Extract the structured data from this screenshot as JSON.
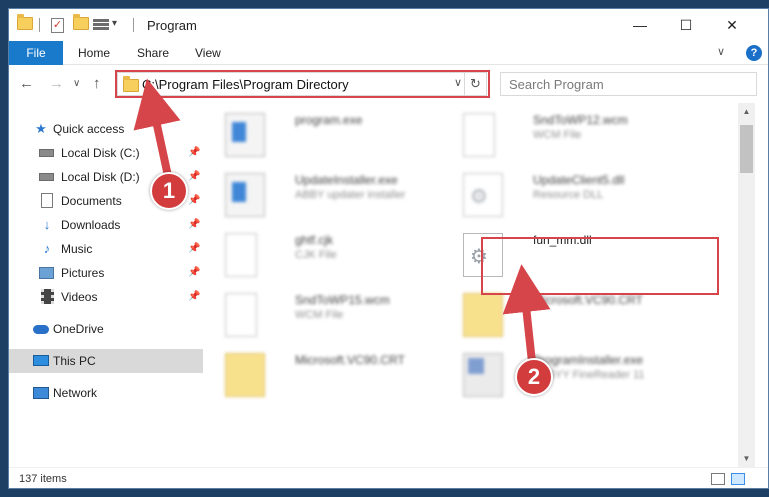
{
  "window": {
    "title": "Program",
    "minimize_glyph": "—",
    "maximize_glyph": "☐",
    "close_glyph": "✕"
  },
  "quick_access_toolbar": {
    "dropdown_glyph": "▾"
  },
  "ribbon": {
    "tabs": [
      "File",
      "Home",
      "Share",
      "View"
    ],
    "expand_glyph": "∨",
    "help_glyph": "?"
  },
  "address": {
    "back_glyph": "←",
    "forward_glyph": "→",
    "recent_glyph": "∨",
    "up_glyph": "↑",
    "path": "C:\\Program Files\\Program Directory",
    "dropdown_glyph": "∨",
    "refresh_glyph": "↻",
    "search_placeholder": "Search Program",
    "search_glyph": "⌕"
  },
  "nav": {
    "items": [
      {
        "label": "Quick access",
        "icon": "star-icon",
        "pinned": false
      },
      {
        "label": "Local Disk (C:)",
        "icon": "drive-icon",
        "pinned": true
      },
      {
        "label": "Local Disk (D:)",
        "icon": "drive-icon",
        "pinned": true
      },
      {
        "label": "Documents",
        "icon": "documents-icon",
        "pinned": true
      },
      {
        "label": "Downloads",
        "icon": "download-icon",
        "pinned": true
      },
      {
        "label": "Music",
        "icon": "music-icon",
        "pinned": true
      },
      {
        "label": "Pictures",
        "icon": "pictures-icon",
        "pinned": true
      },
      {
        "label": "Videos",
        "icon": "videos-icon",
        "pinned": true
      },
      {
        "label": "OneDrive",
        "icon": "onedrive-icon",
        "pinned": false
      },
      {
        "label": "This PC",
        "icon": "this-pc-icon",
        "pinned": false,
        "selected": true
      },
      {
        "label": "Network",
        "icon": "network-icon",
        "pinned": false
      }
    ],
    "pin_glyph": "📌"
  },
  "files": [
    {
      "name": "program.exe",
      "desc": "",
      "icon": "exe-icon",
      "blurred": true
    },
    {
      "name": "SndToWP12.wcm",
      "desc": "WCM File",
      "icon": "file-icon",
      "blurred": true
    },
    {
      "name": "UpdateInstaller.exe",
      "desc": "ABBY updater installer",
      "icon": "exe-icon",
      "blurred": true
    },
    {
      "name": "UpdateClient5.dll",
      "desc": "Resource DLL",
      "icon": "dll-icon",
      "blurred": true
    },
    {
      "name": "ghtf.cjk",
      "desc": "CJK File",
      "icon": "file-icon",
      "blurred": true
    },
    {
      "name": "fun_mm.dll",
      "desc": "",
      "icon": "dll-icon",
      "blurred": false
    },
    {
      "name": "SndToWP15.wcm",
      "desc": "WCM File",
      "icon": "file-icon",
      "blurred": true
    },
    {
      "name": "Microsoft.VC90.CRT",
      "desc": "",
      "icon": "yellow-file-icon",
      "blurred": true
    },
    {
      "name": "Microsoft.VC90.CRT",
      "desc": "",
      "icon": "yellow-file-icon",
      "blurred": true
    },
    {
      "name": "ProgramInstaller.exe",
      "desc": "ABBYY FineReader 11",
      "icon": "installer-icon",
      "blurred": true
    }
  ],
  "annotations": {
    "badge1": "1",
    "badge2": "2",
    "accent": "#d6454a"
  },
  "scrollbar": {
    "up_glyph": "▲",
    "down_glyph": "▼"
  },
  "status": {
    "item_count": "137 items"
  }
}
